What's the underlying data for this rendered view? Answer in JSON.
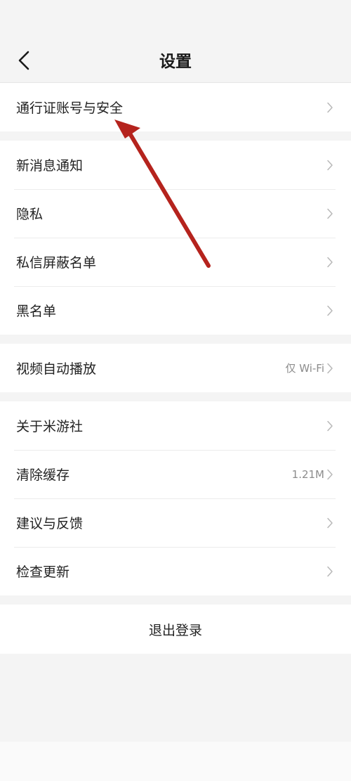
{
  "header": {
    "title": "设置",
    "back_icon": "chevron-left-icon"
  },
  "groups": [
    {
      "items": [
        {
          "label": "通行证账号与安全",
          "value": ""
        }
      ]
    },
    {
      "items": [
        {
          "label": "新消息通知",
          "value": ""
        },
        {
          "label": "隐私",
          "value": ""
        },
        {
          "label": "私信屏蔽名单",
          "value": ""
        },
        {
          "label": "黑名单",
          "value": ""
        }
      ]
    },
    {
      "items": [
        {
          "label": "视频自动播放",
          "value": "仅 Wi-Fi"
        }
      ]
    },
    {
      "items": [
        {
          "label": "关于米游社",
          "value": ""
        },
        {
          "label": "清除缓存",
          "value": "1.21M"
        },
        {
          "label": "建议与反馈",
          "value": ""
        },
        {
          "label": "检查更新",
          "value": ""
        }
      ]
    }
  ],
  "logout": {
    "label": "退出登录"
  },
  "annotation": {
    "color": "#b5231d",
    "icon": "red-arrow-pointer"
  },
  "colors": {
    "background": "#f4f4f4",
    "card": "#ffffff",
    "chevron": "#b8b8b8"
  }
}
